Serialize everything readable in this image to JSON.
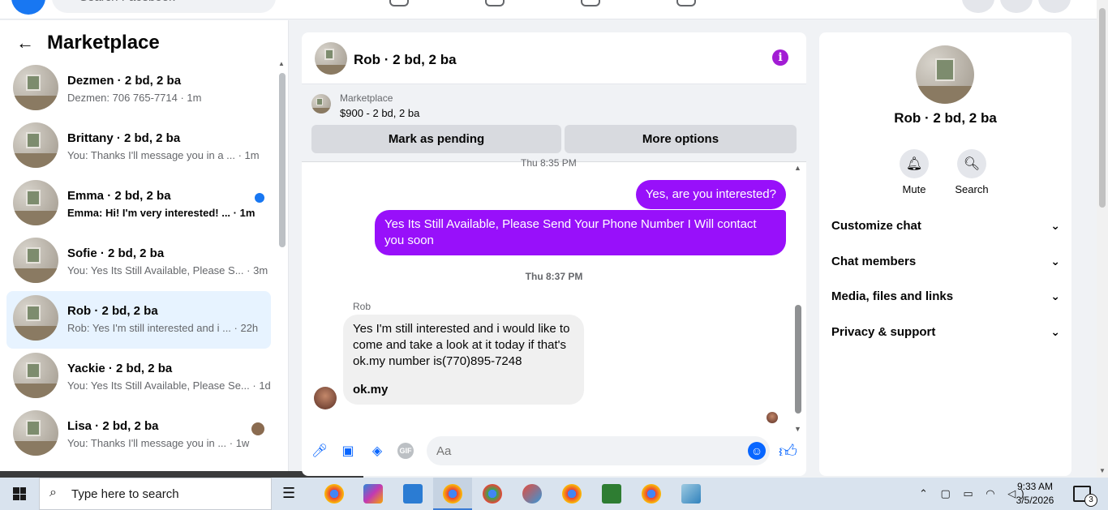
{
  "topbar": {
    "search_placeholder": "Search Facebook"
  },
  "sidebar": {
    "title": "Marketplace",
    "conversations": [
      {
        "name": "Dezmen · 2 bd, 2 ba",
        "snippet": "Dezmen: 706 765-7714 · 1m"
      },
      {
        "name": "Brittany · 2 bd, 2 ba",
        "snippet": "You: Thanks I'll message you in a ... · 1m"
      },
      {
        "name": "Emma · 2 bd, 2 ba",
        "snippet": "Emma: Hi! I'm very interested! ... · 1m"
      },
      {
        "name": "Sofie · 2 bd, 2 ba",
        "snippet": "You: Yes Its Still Available, Please S... · 3m"
      },
      {
        "name": "Rob · 2 bd, 2 ba",
        "snippet": "Rob: Yes I'm still interested and i ... · 22h"
      },
      {
        "name": "Yackie · 2 bd, 2 ba",
        "snippet": "You: Yes Its Still Available, Please Se... · 1d"
      },
      {
        "name": "Lisa · 2 bd, 2 ba",
        "snippet": "You: Thanks I'll message you in ... · 1w"
      }
    ]
  },
  "chat": {
    "title": "Rob · 2 bd, 2 ba",
    "marketplace": {
      "label": "Marketplace",
      "price": "$900 - 2 bd, 2 ba",
      "mark_pending": "Mark as pending",
      "more_options": "More options"
    },
    "cut_time": "Thu 8:35 PM",
    "out_msg_1": "Yes, are you interested?",
    "out_msg_2": "Yes Its Still Available, Please Send Your Phone Number I Will contact you soon",
    "timestamp": "Thu 8:37 PM",
    "sender": "Rob",
    "in_msg": "Yes I'm still interested and i would like to come and take a look at it today if that's ok.my number is(770)895-7248",
    "in_link": "ok.my",
    "input_placeholder": "Aa"
  },
  "info": {
    "name": "Rob · 2 bd, 2 ba",
    "mute_label": "Mute",
    "search_label": "Search",
    "sections": [
      "Customize chat",
      "Chat members",
      "Media, files and links",
      "Privacy & support"
    ]
  },
  "taskbar": {
    "search_text": "Type here to search",
    "time": "9:33 AM",
    "date": "3/5/2026",
    "notif_count": "3"
  },
  "colors": {
    "accent_purple": "#9810fa",
    "brand_blue": "#1877f2",
    "active_row": "#e7f3ff"
  }
}
